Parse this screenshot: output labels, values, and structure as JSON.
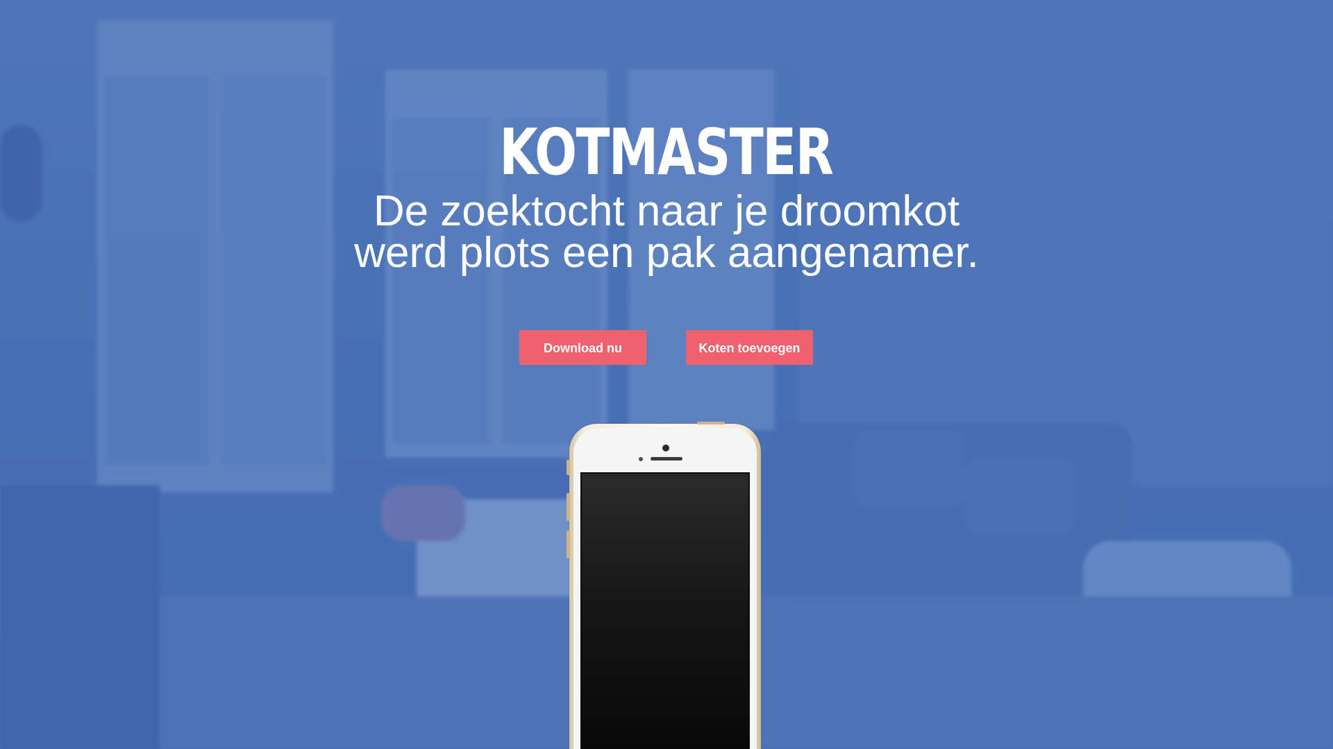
{
  "hero": {
    "brand": "KOTMASTER",
    "tagline_line1": "De zoektocht naar je droomkot",
    "tagline_line2": "werd plots een pak aangenamer.",
    "background_image": "blurred-living-room-photo"
  },
  "buttons": {
    "download_label": "Download nu",
    "add_label": "Koten toevoegen"
  },
  "colors": {
    "overlay_blue": "#4a72b6",
    "button_accent": "#f0616f",
    "text": "#ffffff"
  },
  "device": {
    "type": "smartphone",
    "icon": "phone-mockup",
    "screen": "blank-dark"
  }
}
